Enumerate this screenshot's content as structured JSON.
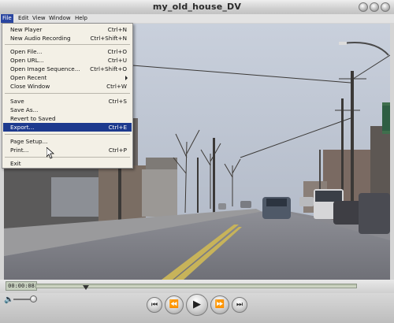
{
  "window": {
    "title": "my_old_house_DV"
  },
  "menubar": {
    "items": [
      "File",
      "Edit",
      "View",
      "Window",
      "Help"
    ]
  },
  "file_menu": {
    "group1": [
      {
        "label": "New Player",
        "shortcut": "Ctrl+N"
      },
      {
        "label": "New Audio Recording",
        "shortcut": "Ctrl+Shift+N"
      }
    ],
    "group2": [
      {
        "label": "Open File...",
        "shortcut": "Ctrl+O"
      },
      {
        "label": "Open URL...",
        "shortcut": "Ctrl+U"
      },
      {
        "label": "Open Image Sequence...",
        "shortcut": "Ctrl+Shift+O"
      },
      {
        "label": "Open Recent",
        "shortcut": ""
      },
      {
        "label": "Close Window",
        "shortcut": "Ctrl+W"
      }
    ],
    "group3": [
      {
        "label": "Save",
        "shortcut": "Ctrl+S"
      },
      {
        "label": "Save As...",
        "shortcut": ""
      },
      {
        "label": "Revert to Saved",
        "shortcut": ""
      },
      {
        "label": "Export...",
        "shortcut": "Ctrl+E"
      }
    ],
    "group4": [
      {
        "label": "Page Setup...",
        "shortcut": ""
      },
      {
        "label": "Print...",
        "shortcut": "Ctrl+P"
      }
    ],
    "group5": [
      {
        "label": "Exit",
        "shortcut": ""
      }
    ],
    "highlighted": "Export..."
  },
  "player": {
    "timecode": "00:00:08",
    "playhead_position": 0.16,
    "volume_level": 0.75
  },
  "controls": [
    "go-to-start",
    "rewind",
    "play",
    "fast-forward",
    "go-to-end"
  ],
  "colors": {
    "menu_highlight": "#1d3a8e",
    "menu_background": "#f3f0e6",
    "titlebar": "#cfcfcf"
  }
}
